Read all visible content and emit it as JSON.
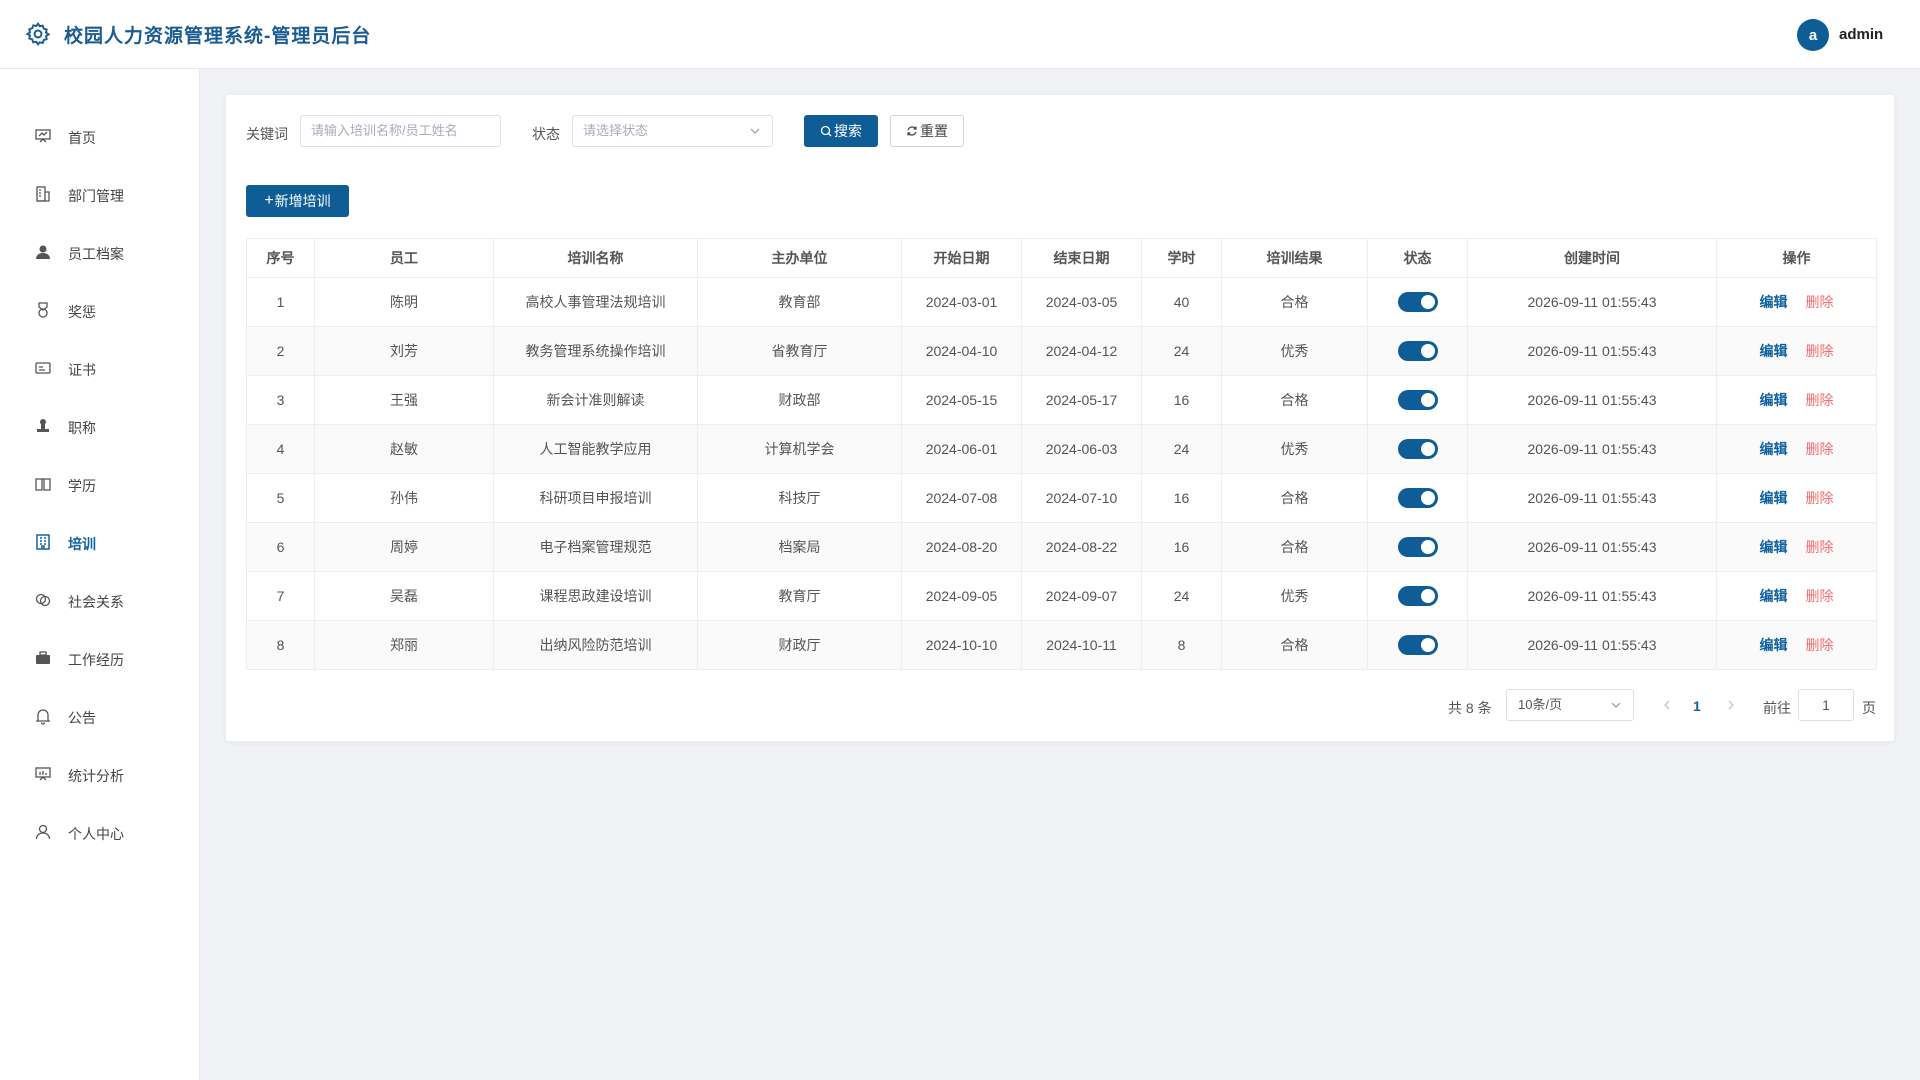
{
  "header": {
    "title": "校园人力资源管理系统-管理员后台",
    "avatar_letter": "a",
    "username": "admin",
    "brand_color": "#0f5d96"
  },
  "sidebar": {
    "items": [
      {
        "label": "首页",
        "icon": "dashboard-icon"
      },
      {
        "label": "部门管理",
        "icon": "building-icon"
      },
      {
        "label": "员工档案",
        "icon": "user-icon"
      },
      {
        "label": "奖惩",
        "icon": "medal-icon"
      },
      {
        "label": "证书",
        "icon": "certificate-icon"
      },
      {
        "label": "职称",
        "icon": "stamp-icon"
      },
      {
        "label": "学历",
        "icon": "book-icon"
      },
      {
        "label": "培训",
        "icon": "office-building-icon",
        "active": true
      },
      {
        "label": "社会关系",
        "icon": "relations-icon"
      },
      {
        "label": "工作经历",
        "icon": "briefcase-icon"
      },
      {
        "label": "公告",
        "icon": "bell-icon"
      },
      {
        "label": "统计分析",
        "icon": "chart-board-icon"
      },
      {
        "label": "个人中心",
        "icon": "person-icon"
      }
    ]
  },
  "filters": {
    "keyword_label": "关键词",
    "keyword_placeholder": "请输入培训名称/员工姓名",
    "status_label": "状态",
    "status_placeholder": "请选择状态",
    "search_label": "搜索",
    "reset_label": "重置",
    "add_label": "新增培训"
  },
  "table": {
    "columns": [
      "序号",
      "员工",
      "培训名称",
      "主办单位",
      "开始日期",
      "结束日期",
      "学时",
      "培训结果",
      "状态",
      "创建时间",
      "操作"
    ],
    "edit_label": "编辑",
    "delete_label": "删除",
    "rows": [
      {
        "no": "1",
        "employee": "陈明",
        "name": "高校人事管理法规培训",
        "org": "教育部",
        "start": "2024-03-01",
        "end": "2024-03-05",
        "hours": "40",
        "result": "合格",
        "enabled": true,
        "created": "2026-09-11 01:55:43"
      },
      {
        "no": "2",
        "employee": "刘芳",
        "name": "教务管理系统操作培训",
        "org": "省教育厅",
        "start": "2024-04-10",
        "end": "2024-04-12",
        "hours": "24",
        "result": "优秀",
        "enabled": true,
        "created": "2026-09-11 01:55:43"
      },
      {
        "no": "3",
        "employee": "王强",
        "name": "新会计准则解读",
        "org": "财政部",
        "start": "2024-05-15",
        "end": "2024-05-17",
        "hours": "16",
        "result": "合格",
        "enabled": true,
        "created": "2026-09-11 01:55:43"
      },
      {
        "no": "4",
        "employee": "赵敏",
        "name": "人工智能教学应用",
        "org": "计算机学会",
        "start": "2024-06-01",
        "end": "2024-06-03",
        "hours": "24",
        "result": "优秀",
        "enabled": true,
        "created": "2026-09-11 01:55:43"
      },
      {
        "no": "5",
        "employee": "孙伟",
        "name": "科研项目申报培训",
        "org": "科技厅",
        "start": "2024-07-08",
        "end": "2024-07-10",
        "hours": "16",
        "result": "合格",
        "enabled": true,
        "created": "2026-09-11 01:55:43"
      },
      {
        "no": "6",
        "employee": "周婷",
        "name": "电子档案管理规范",
        "org": "档案局",
        "start": "2024-08-20",
        "end": "2024-08-22",
        "hours": "16",
        "result": "合格",
        "enabled": true,
        "created": "2026-09-11 01:55:43"
      },
      {
        "no": "7",
        "employee": "吴磊",
        "name": "课程思政建设培训",
        "org": "教育厅",
        "start": "2024-09-05",
        "end": "2024-09-07",
        "hours": "24",
        "result": "优秀",
        "enabled": true,
        "created": "2026-09-11 01:55:43"
      },
      {
        "no": "8",
        "employee": "郑丽",
        "name": "出纳风险防范培训",
        "org": "财政厅",
        "start": "2024-10-10",
        "end": "2024-10-11",
        "hours": "8",
        "result": "合格",
        "enabled": true,
        "created": "2026-09-11 01:55:43"
      }
    ]
  },
  "pagination": {
    "total_text": "共 8 条",
    "page_size": "10条/页",
    "current_page": "1",
    "goto_label": "前往",
    "goto_value": "1",
    "page_unit": "页"
  }
}
